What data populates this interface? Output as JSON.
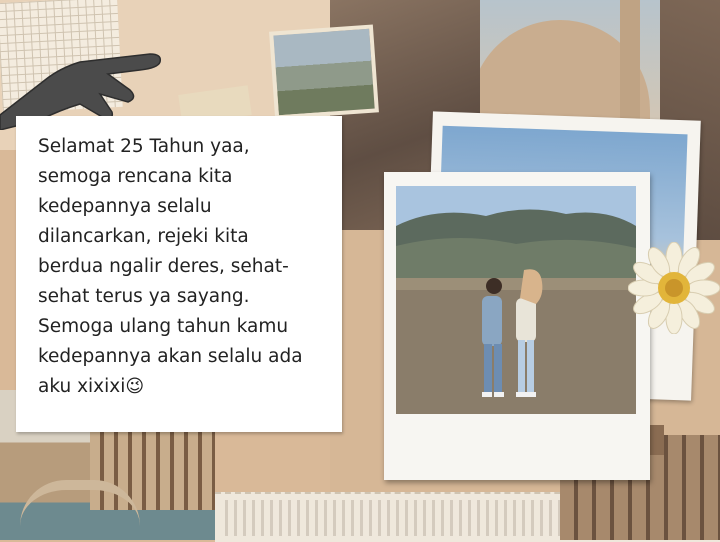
{
  "note": {
    "lines": [
      "Selamat 25 Tahun yaa,",
      "semoga rencana kita",
      "kedepannya selalu",
      "dilancarkan, rejeki kita",
      "berdua ngalir deres, sehat-",
      "sehat terus ya sayang.",
      "Semoga ulang tahun kamu",
      "kedepannya akan selalu ada",
      "aku xixixi"
    ],
    "emoji": "😉"
  },
  "colors": {
    "kraft": "#d9b998",
    "note_paper": "#ffffff",
    "polaroid_frame": "#f7f6f2",
    "text": "#222222"
  },
  "icons": {
    "wink": "wink-emoji-icon",
    "flower": "daisy-flower-icon",
    "hand": "pointing-hand-icon"
  }
}
